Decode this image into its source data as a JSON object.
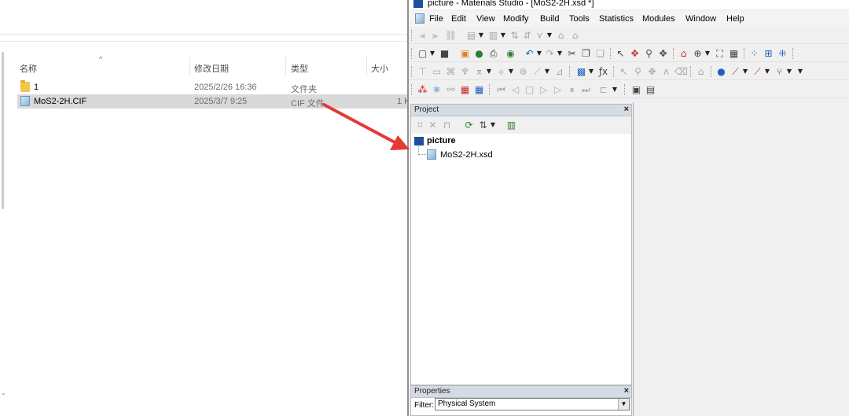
{
  "explorer": {
    "columns": [
      "名称",
      "修改日期",
      "类型",
      "大小"
    ],
    "files": [
      {
        "name": "1",
        "date": "2025/2/26 16:36",
        "type": "文件夹",
        "size": "",
        "icon": "folder-icon"
      },
      {
        "name": "MoS2-2H.CIF",
        "date": "2025/3/7 9:25",
        "type": "CIF 文件",
        "size": "1 K",
        "icon": "cif-file-icon",
        "selected": true
      }
    ]
  },
  "ms": {
    "title": "picture - Materials Studio - [MoS2-2H.xsd *]",
    "menu": [
      "File",
      "Edit",
      "View",
      "Modify",
      "Build",
      "Tools",
      "Statistics",
      "Modules",
      "Window",
      "Help"
    ],
    "project_pane": {
      "header": "Project",
      "close": "×",
      "project_name": "picture",
      "document": "MoS2-2H.xsd"
    },
    "properties_pane": {
      "header": "Properties",
      "close": "×",
      "filter_label": "Filter:",
      "filter_value": "Physical System"
    }
  },
  "annotation": {
    "arrow_color": "#e53935"
  }
}
